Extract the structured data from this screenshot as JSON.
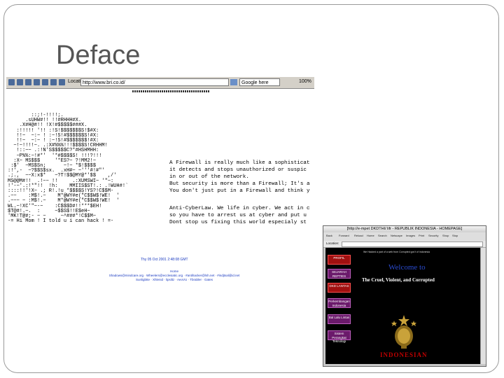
{
  "slide": {
    "title": "Deface"
  },
  "shot1": {
    "location_label": "Location:",
    "url": "http://www.bri.co.id/",
    "search_placeholder": "Google here",
    "zoom": "100%",
    "ascii_art": "        ::;!-!!!!;.\n      .sUHW#!! !!#RHHH#X.\n    .X#H@#!! !X!#$$$$$###X.\n   :!!!!! '!! :!S!$$$$$$$S!$#X:\n   !!~  ~:~ ! :~!S!#$$$$$$S!#X:\n   !!~  ~:~ ! :~!S!#$$$$$$$!#X:\n  ~!~!!!!~. .:X#%%%!!!$$$$S!CRHHM!\n   !::~~ .:!N'S$$$$$C?*#HSHMHH:\n   ~P%%:~!#*'  '*#$$$$S! !!!?!!!\n  :X~ MS$$$     '*ES?~ ?!MM2!~\n :$'  ~MS$Sn;      ~!~ *$!$$$$\n:!',-  ~?$$S$sx.  .xH#~ ~'''#!#\"'\n.;.,  ~~X:x$*   ~?T!$$@MY@*'$$    ,/'\nMS@@M#!!  .!~~ !!     .:XUMSWI~ '\"~:\n!'-~'.:!*\"!!  !h:    MMIIS$ST!.: .!WUH#!`\n::::!!'!X~ .; R!.!u *$$$$S!YS?!C$$M-\n.~~    :M$!.~    M*@WY#e(\"C$$W$!WE!  '\n.~~~ ~ :M$!.~    M*@WY#e(\"C$$W$!WE!  '\nWL.~!XC'\"~-~    :C$$$D#!!***$EH!\n$T@#!.~.  :     ~$$S$!!E$eH~\n'MK!T@#;- ~ ~     ~^###*!C$$M~\n-= Hi Mom ! I told u i can hack ! =-",
    "firewall_text": "A Firewall is really much like a sophisticat\nit detects and stops unauthorized or suspic\nin or out of the network.\nBut security is more than a Firewall; It's a\nYou don't just put in a Firewall and think y",
    "cyberlaw_text": "Anti-CyberLaw. We life in cyber. We act in c\nso you have to arrest us at cyber and put u\nDont stop us fixing this world especialy st",
    "link_text": "Thy 05 Oct 2001 2:48:08 GMT",
    "footer_lines": [
      "Home",
      "Shadows@mindcare.org · Wheelers@ecclesiatic.org · #antihacker@lsh.net · #indjtsal@id.net",
      "Sunligbtte  ·  Xhlenid  ·  lipsiltz  ·  AeoVU  ·  Tbrabler  ·  Gates"
    ]
  },
  "shot2": {
    "window_title": "[http://e-mpet DKDTHI/ lifr - REPUBLIK INDONESIA - HOMEPAGE]",
    "nav_items": [
      "Back",
      "Forward",
      "Reload",
      "Home",
      "Search",
      "Netscape",
      "Images",
      "Print",
      "Security",
      "Shop",
      "Stop"
    ],
    "location_label": "Location:",
    "subhead": "We Hacked a part of a web from Corrupted gov't of Indonesia",
    "welcome": "Welcome to",
    "cruel": "The Cruel, Violent, and Corrupted",
    "country": "INDONESIAN",
    "side_buttons": [
      "PROFIL",
      "SEJARAH REPTIES",
      "DKD LANTAS",
      "Perkembangan Indonesia",
      "Bal Lalu Lintas",
      "Sistem Perangkat Teknologi"
    ]
  }
}
